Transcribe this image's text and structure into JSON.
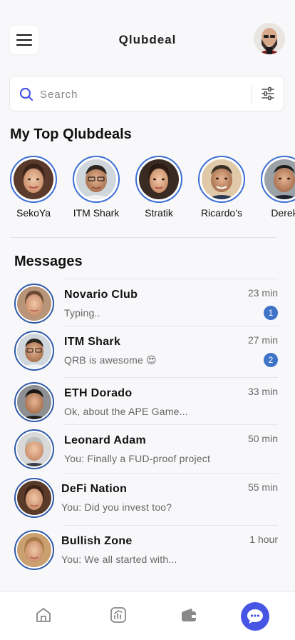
{
  "app": {
    "title": "Qlubdeal"
  },
  "search": {
    "placeholder": "Search",
    "value": ""
  },
  "top_deals": {
    "title": "My Top Qlubdeals",
    "items": [
      {
        "name": "SekoYa"
      },
      {
        "name": "ITM Shark"
      },
      {
        "name": "Stratik"
      },
      {
        "name": "Ricardo’s"
      },
      {
        "name": "Derek"
      }
    ]
  },
  "messages": {
    "title": "Messages",
    "items": [
      {
        "name": "Novario Club",
        "preview": "Typing..",
        "time": "23 min",
        "unread": "1"
      },
      {
        "name": "ITM Shark",
        "preview": "QRB is awesome 😍",
        "time": "27 min",
        "unread": "2"
      },
      {
        "name": "ETH Dorado",
        "preview": "Ok, about the APE Game...",
        "time": "33 min",
        "unread": null
      },
      {
        "name": "Leonard Adam",
        "preview": "You: Finally a  FUD-proof project",
        "time": "50 min",
        "unread": null
      },
      {
        "name": "DeFi Nation",
        "preview": "You: Did you invest too?",
        "time": "55 min",
        "unread": null
      },
      {
        "name": "Bullish Zone",
        "preview": "You: We all started with...",
        "time": "1 hour",
        "unread": null
      }
    ]
  },
  "nav": {
    "items": [
      "home-icon",
      "chart-icon",
      "wallet-icon",
      "chat-icon"
    ]
  },
  "colors": {
    "accent": "#4655e4",
    "ring": "#3d6fd4",
    "badge": "#3f73c8"
  }
}
